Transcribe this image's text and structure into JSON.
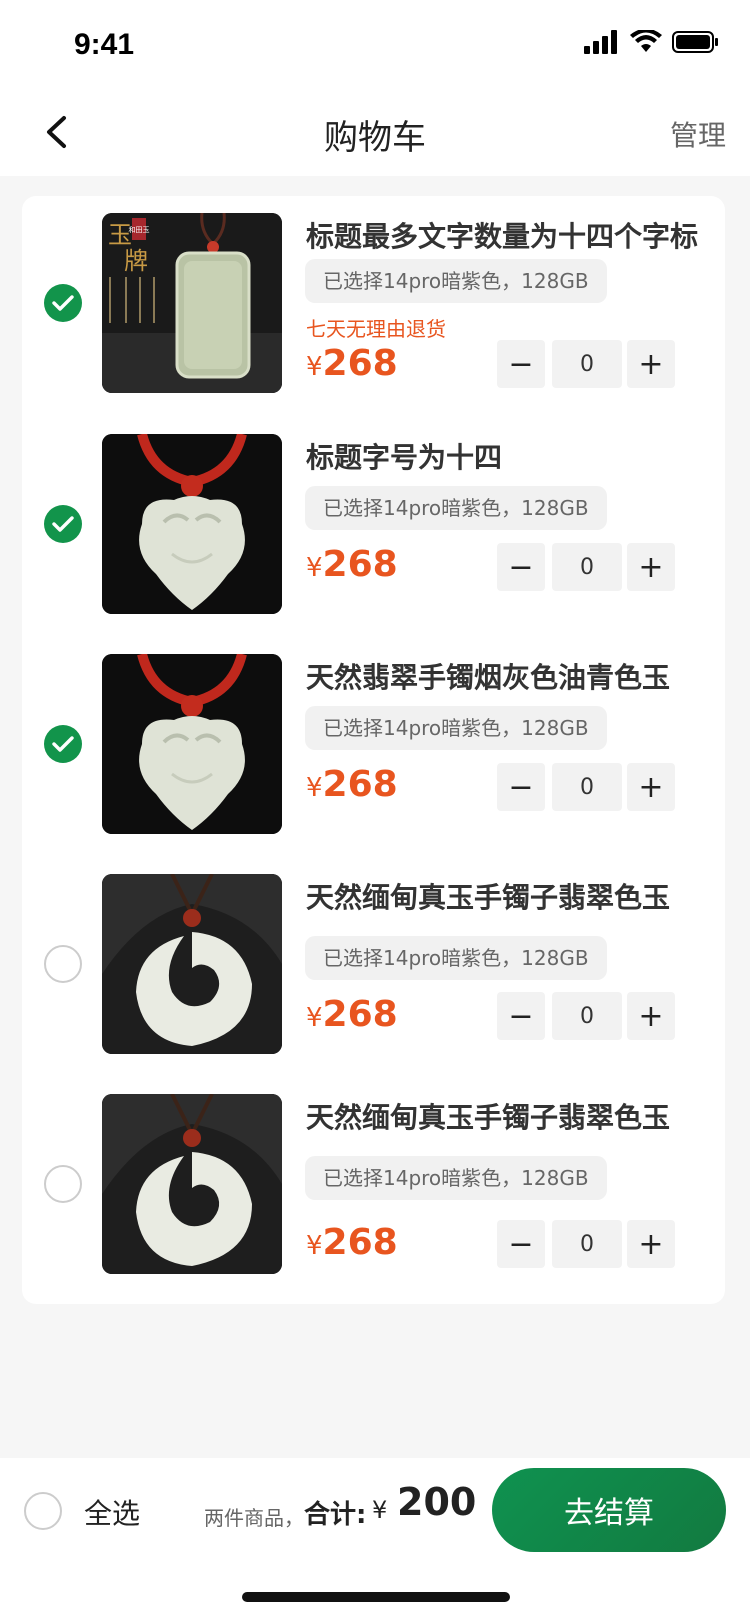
{
  "status": {
    "time": "9:41"
  },
  "nav": {
    "title": "购物车",
    "manage": "管理"
  },
  "items": [
    {
      "title": "标题最多文字数量为十四个字标",
      "spec": "已选择14pro暗紫色，128GB",
      "tag": "七天无理由退货",
      "price_symbol": "¥",
      "price": "268",
      "quantity": "0",
      "selected": true,
      "image": "jade-pendant-rectangular"
    },
    {
      "title": "标题字号为十四",
      "spec": "已选择14pro暗紫色，128GB",
      "tag": "",
      "price_symbol": "¥",
      "price": "268",
      "quantity": "0",
      "selected": true,
      "image": "jade-pendant-ruyi"
    },
    {
      "title": "天然翡翠手镯烟灰色油青色玉",
      "spec": "已选择14pro暗紫色，128GB",
      "tag": "",
      "price_symbol": "¥",
      "price": "268",
      "quantity": "0",
      "selected": true,
      "image": "jade-pendant-ruyi"
    },
    {
      "title": "天然缅甸真玉手镯子翡翠色玉",
      "spec": "已选择14pro暗紫色，128GB",
      "tag": "",
      "price_symbol": "¥",
      "price": "268",
      "quantity": "0",
      "selected": false,
      "image": "jade-pendant-swirl"
    },
    {
      "title": "天然缅甸真玉手镯子翡翠色玉",
      "spec": "已选择14pro暗紫色，128GB",
      "tag": "",
      "price_symbol": "¥",
      "price": "268",
      "quantity": "0",
      "selected": false,
      "image": "jade-pendant-swirl"
    }
  ],
  "stepper": {
    "minus": "−",
    "plus": "+"
  },
  "thumb_text": {
    "big1": "玉",
    "big2": "牌",
    "seal": "和田玉"
  },
  "bottom": {
    "select_all": "全选",
    "count_text": "两件商品，",
    "total_label": "合计:",
    "total_symbol": "¥",
    "total_amount": "200",
    "checkout": "去结算"
  },
  "colors": {
    "accent": "#12944b",
    "price": "#e8551f"
  }
}
